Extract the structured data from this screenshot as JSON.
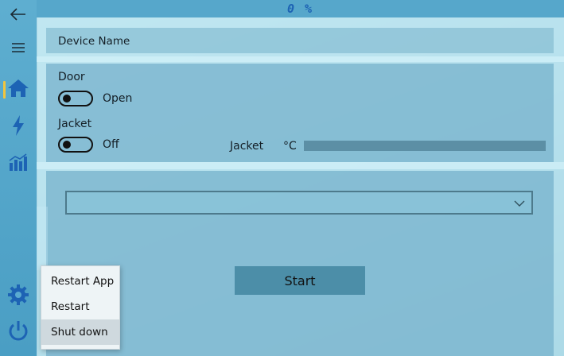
{
  "status": {
    "percent": "0 %"
  },
  "nav": {
    "back": "back-arrow-icon",
    "menu": "hamburger-menu-icon",
    "items": [
      {
        "icon": "home-icon",
        "active": true
      },
      {
        "icon": "lightning-icon",
        "active": false
      },
      {
        "icon": "chart-icon",
        "active": false
      }
    ],
    "settings": "gear-icon",
    "power": "power-icon"
  },
  "device": {
    "name_label": "Device Name"
  },
  "door": {
    "label": "Door",
    "state": "Open"
  },
  "jacket": {
    "label": "Jacket",
    "state": "Off",
    "temp_label": "Jacket",
    "unit": "°C"
  },
  "program": {
    "selected": ""
  },
  "actions": {
    "start": "Start"
  },
  "power_menu": {
    "items": [
      "Restart App",
      "Restart",
      "Shut down"
    ],
    "highlighted": "Shut down"
  },
  "colors": {
    "accent": "#1d63b4",
    "active_indicator": "#f2c53d"
  }
}
